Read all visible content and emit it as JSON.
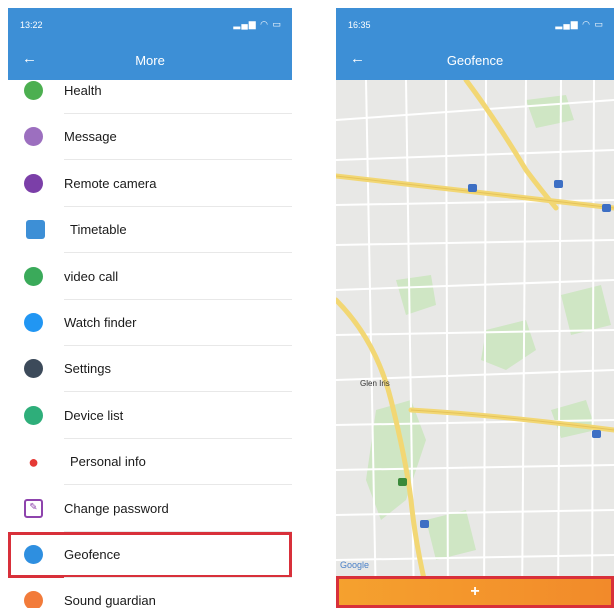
{
  "left": {
    "status_time": "13:22",
    "status_icons": "▂▄▆ ◠ ▭",
    "title": "More",
    "back_glyph": "←",
    "items": [
      {
        "label": "Health",
        "icon": "health-icon",
        "color": "#4caf50"
      },
      {
        "label": "Message",
        "icon": "message-icon",
        "color": "#9c6fbf"
      },
      {
        "label": "Remote camera",
        "icon": "camera-icon",
        "color": "#7b3fa8"
      },
      {
        "label": "Timetable",
        "icon": "timetable-icon",
        "color": "#3d8fd6"
      },
      {
        "label": "video call",
        "icon": "phone-icon",
        "color": "#3aaa5a"
      },
      {
        "label": "Watch finder",
        "icon": "search-icon",
        "color": "#2196f3"
      },
      {
        "label": "Settings",
        "icon": "gear-icon",
        "color": "#3c4a5a"
      },
      {
        "label": "Device list",
        "icon": "device-list-icon",
        "color": "#2eae7a"
      },
      {
        "label": "Personal info",
        "icon": "person-icon",
        "color": "#e53935"
      },
      {
        "label": "Change password",
        "icon": "edit-icon",
        "color": "#8e44ad"
      },
      {
        "label": "Geofence",
        "icon": "geofence-icon",
        "color": "#2e8fe0"
      },
      {
        "label": "Sound guardian",
        "icon": "sound-icon",
        "color": "#f27b3a"
      }
    ]
  },
  "right": {
    "status_time": "16:35",
    "status_icons": "▂▄▆ ◠ ▭",
    "title": "Geofence",
    "back_glyph": "←",
    "map_labels": [
      "Glen Iris",
      "Google"
    ],
    "add_label": "+"
  }
}
